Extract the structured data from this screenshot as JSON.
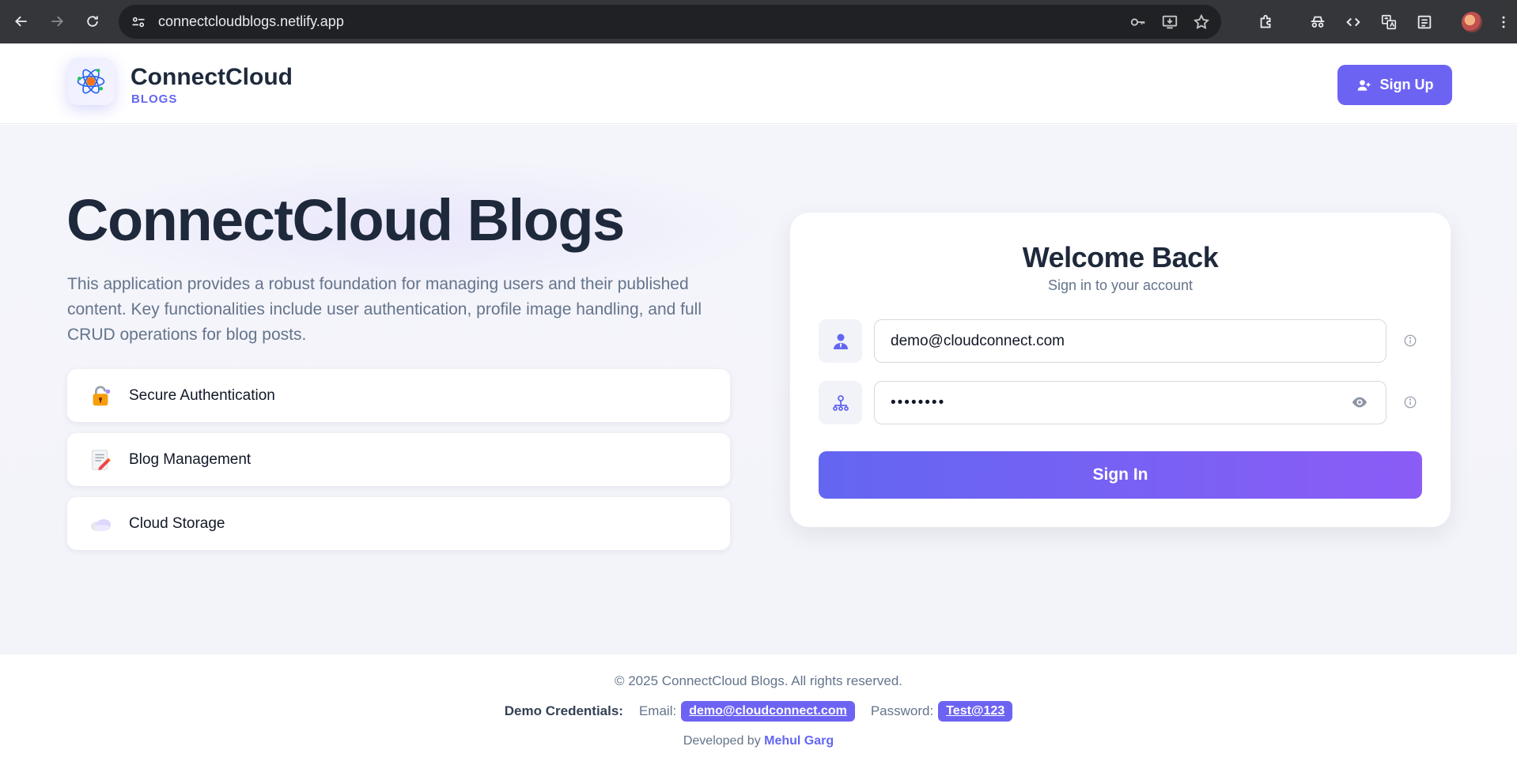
{
  "browser": {
    "url": "connectcloudblogs.netlify.app"
  },
  "header": {
    "brand_name": "ConnectCloud",
    "brand_sub": "BLOGS",
    "signup_label": "Sign Up"
  },
  "hero": {
    "title": "ConnectCloud Blogs",
    "description": "This application provides a robust foundation for managing users and their published content. Key functionalities include user authentication, profile image handling, and full CRUD operations for blog posts.",
    "features": [
      {
        "label": "Secure Authentication",
        "icon": "lock-icon"
      },
      {
        "label": "Blog Management",
        "icon": "memo-icon"
      },
      {
        "label": "Cloud Storage",
        "icon": "cloud-icon"
      }
    ]
  },
  "login": {
    "title": "Welcome Back",
    "subtitle": "Sign in to your account",
    "email_value": "demo@cloudconnect.com",
    "password_value": "••••••••",
    "signin_label": "Sign In"
  },
  "footer": {
    "copyright": "© 2025 ConnectCloud Blogs. All rights reserved.",
    "demo_label": "Demo Credentials:",
    "email_key": "Email:",
    "email_value": "demo@cloudconnect.com",
    "password_key": "Password:",
    "password_value": "Test@123",
    "developed_by": "Developed by",
    "author": "Mehul Garg"
  },
  "colors": {
    "accent": "#6d63f2",
    "text_dark": "#1e293b",
    "text_muted": "#64748b"
  }
}
